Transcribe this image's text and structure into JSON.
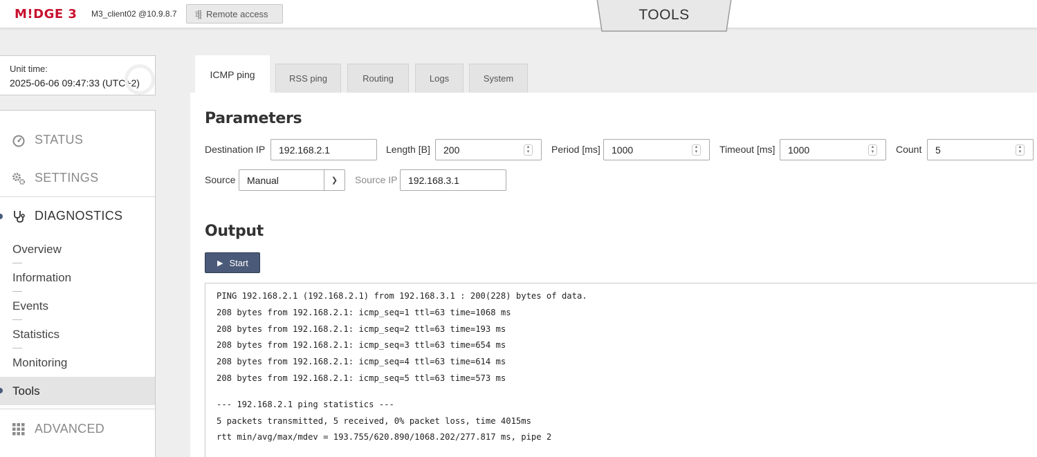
{
  "app": {
    "logo": "M!DGE 3",
    "connection": "M3_client02 @10.9.8.7",
    "remote_access_label": "Remote access",
    "section_title": "TOOLS"
  },
  "unit_time": {
    "label": "Unit time:",
    "value": "2025-06-06 09:47:33 (UTC+2)"
  },
  "sidebar": {
    "main": [
      {
        "label": "STATUS",
        "icon": "gauge-icon"
      },
      {
        "label": "SETTINGS",
        "icon": "gears-icon"
      },
      {
        "label": "DIAGNOSTICS",
        "icon": "stethoscope-icon"
      },
      {
        "label": "ADVANCED",
        "icon": "grid-icon"
      }
    ],
    "diagnostics_items": [
      "Overview",
      "Information",
      "Events",
      "Statistics",
      "Monitoring",
      "Tools"
    ],
    "active_item": "Tools"
  },
  "tabs": [
    "ICMP ping",
    "RSS ping",
    "Routing",
    "Logs",
    "System"
  ],
  "active_tab": "ICMP ping",
  "parameters": {
    "title": "Parameters",
    "destination_ip_label": "Destination IP",
    "destination_ip": "192.168.2.1",
    "length_label": "Length [B]",
    "length": "200",
    "period_label": "Period [ms]",
    "period": "1000",
    "timeout_label": "Timeout [ms]",
    "timeout": "1000",
    "count_label": "Count",
    "count": "5",
    "source_label": "Source",
    "source": "Manual",
    "source_ip_label": "Source IP",
    "source_ip": "192.168.3.1"
  },
  "output": {
    "title": "Output",
    "start_label": "Start",
    "lines": [
      "PING 192.168.2.1 (192.168.2.1) from 192.168.3.1 : 200(228) bytes of data.",
      "208 bytes from 192.168.2.1: icmp_seq=1 ttl=63 time=1068 ms",
      "208 bytes from 192.168.2.1: icmp_seq=2 ttl=63 time=193 ms",
      "208 bytes from 192.168.2.1: icmp_seq=3 ttl=63 time=654 ms",
      "208 bytes from 192.168.2.1: icmp_seq=4 ttl=63 time=614 ms",
      "208 bytes from 192.168.2.1: icmp_seq=5 ttl=63 time=573 ms"
    ],
    "stats_lines": [
      "--- 192.168.2.1 ping statistics ---",
      "5 packets transmitted, 5 received, 0% packet loss, time 4015ms",
      "rtt min/avg/max/mdev = 193.755/620.890/1068.202/277.817 ms, pipe 2"
    ]
  }
}
